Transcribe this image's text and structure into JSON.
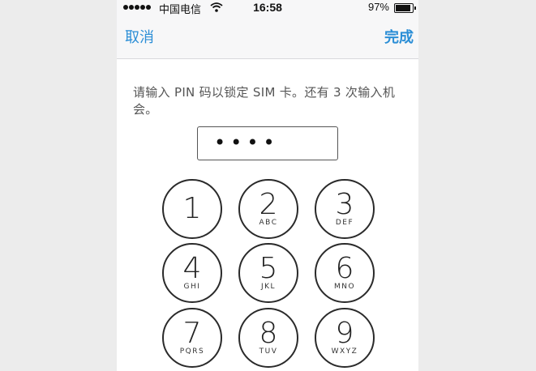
{
  "status_bar": {
    "carrier": "中国电信",
    "time": "16:58",
    "battery": "97%",
    "signal_bars": 5,
    "icons": [
      "signal-icon",
      "wifi-icon",
      "battery-icon"
    ]
  },
  "nav": {
    "cancel_label": "取消",
    "done_label": "完成",
    "accent_color": "#2b8ed6"
  },
  "prompt": {
    "text": "请输入 PIN 码以锁定 SIM 卡。还有 3 次输入机会。"
  },
  "pin_field": {
    "value": "••••"
  },
  "keypad": {
    "keys": [
      {
        "digit": "1",
        "letters": ""
      },
      {
        "digit": "2",
        "letters": "ABC"
      },
      {
        "digit": "3",
        "letters": "DEF"
      },
      {
        "digit": "4",
        "letters": "GHI"
      },
      {
        "digit": "5",
        "letters": "JKL"
      },
      {
        "digit": "6",
        "letters": "MNO"
      },
      {
        "digit": "7",
        "letters": "PQRS"
      },
      {
        "digit": "8",
        "letters": "TUV"
      },
      {
        "digit": "9",
        "letters": "WXYZ"
      }
    ]
  }
}
